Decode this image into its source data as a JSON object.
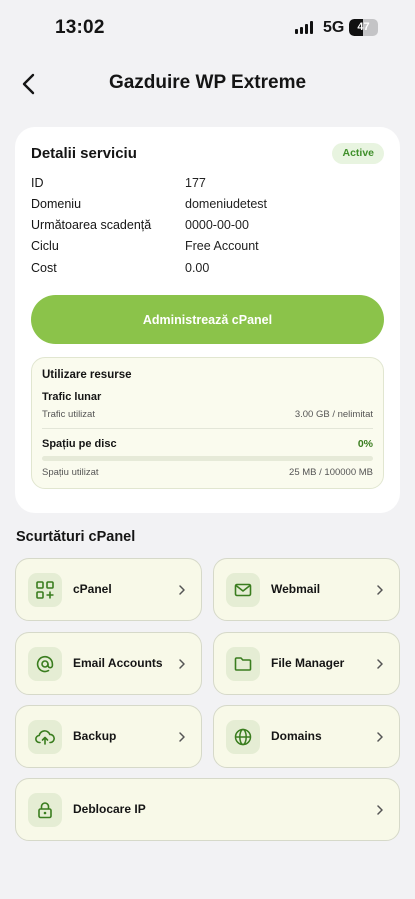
{
  "status_bar": {
    "time": "13:02",
    "network": "5G",
    "battery": "47"
  },
  "header": {
    "title": "Gazduire WP Extreme"
  },
  "service": {
    "title": "Detalii serviciu",
    "status": "Active",
    "rows": [
      {
        "label": "ID",
        "value": "177"
      },
      {
        "label": "Domeniu",
        "value": "domeniudetest"
      },
      {
        "label": "Următoarea scadență",
        "value": "0000-00-00"
      },
      {
        "label": "Ciclu",
        "value": "Free Account"
      },
      {
        "label": "Cost",
        "value": "0.00"
      }
    ],
    "cpanel_button": "Administrează cPanel"
  },
  "resources": {
    "title": "Utilizare resurse",
    "traffic": {
      "title": "Trafic lunar",
      "label": "Trafic utilizat",
      "value": "3.00 GB / nelimitat"
    },
    "disk": {
      "title": "Spațiu pe disc",
      "percent": "0%",
      "label": "Spațiu utilizat",
      "value": "25 MB / 100000 MB",
      "fill_fraction": 0.0
    }
  },
  "shortcuts": {
    "title": "Scurtături cPanel",
    "items": [
      {
        "label": "cPanel",
        "icon": "apps-icon"
      },
      {
        "label": "Webmail",
        "icon": "mail-icon"
      },
      {
        "label": "Email Accounts",
        "icon": "at-icon"
      },
      {
        "label": "File Manager",
        "icon": "folder-icon"
      },
      {
        "label": "Backup",
        "icon": "cloud-upload-icon"
      },
      {
        "label": "Domains",
        "icon": "globe-icon"
      },
      {
        "label": "Deblocare IP",
        "icon": "lock-icon"
      }
    ]
  },
  "colors": {
    "accent": "#8bc34a",
    "badge_text": "#3f8f2a",
    "tile_bg": "#f8f9e8",
    "icon_color": "#3a7d1f"
  }
}
